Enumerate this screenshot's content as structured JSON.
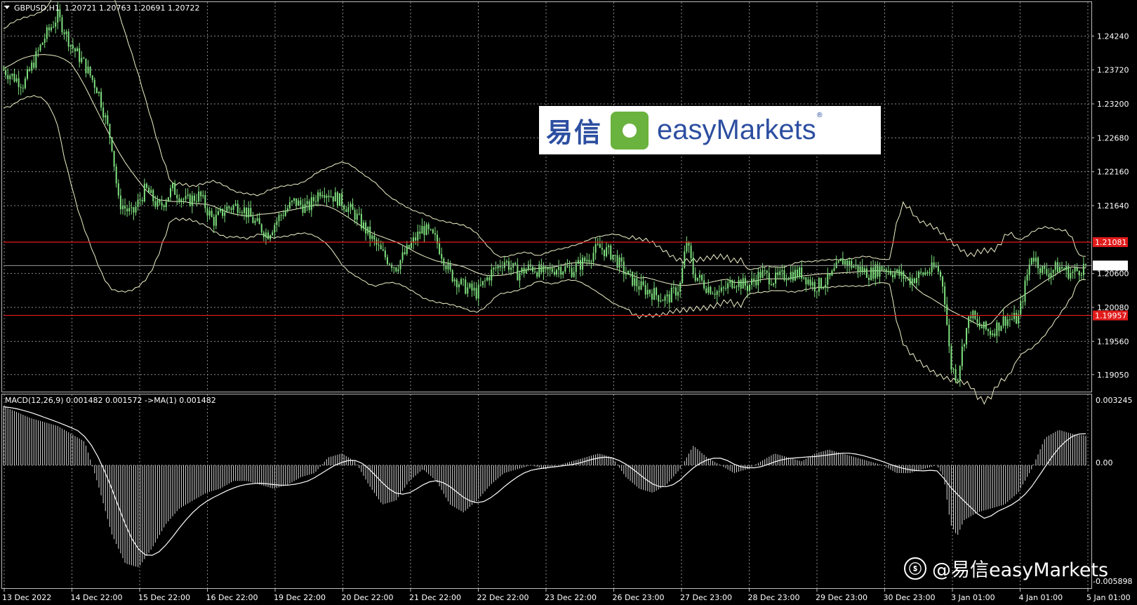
{
  "header": {
    "symbol": "GBPUSD,H1",
    "ohlc": "1.20721 1.20763 1.20691 1.20722",
    "dropdown_icon": "triangle-down-icon"
  },
  "price_axis": {
    "ticks": [
      "1.24240",
      "1.23720",
      "1.23200",
      "1.22680",
      "1.22160",
      "1.21640",
      "1.21081",
      "1.20600",
      "1.20080",
      "1.19957",
      "1.19560",
      "1.19050"
    ],
    "current_price": "1.20722",
    "resistance_label": "1.21081",
    "support_label": "1.19957"
  },
  "indicator": {
    "label": "MACD(12,26,9) 0.001482 0.001572  ->MA(1) 0.001482",
    "axis_top": "0.003245",
    "axis_zero": "0.00",
    "axis_bottom": "-0.005898"
  },
  "time_axis": [
    "13 Dec 2022",
    "14 Dec 22:00",
    "15 Dec 22:00",
    "16 Dec 22:00",
    "19 Dec 22:00",
    "20 Dec 22:00",
    "21 Dec 22:00",
    "22 Dec 22:00",
    "23 Dec 22:00",
    "26 Dec 23:00",
    "27 Dec 23:00",
    "28 Dec 23:00",
    "29 Dec 23:00",
    "30 Dec 23:00",
    "3 Jan 01:00",
    "4 Jan 01:00",
    "5 Jan 01:00"
  ],
  "logo": {
    "cn": "易信",
    "en": "easyMarkets",
    "reg": "®"
  },
  "watermark": {
    "text": "@易信easyMarkets",
    "icon": "weibo-icon"
  },
  "colors": {
    "candle": "#7ee07e",
    "grid": "#8a8a8a",
    "level_line": "#e21b1b",
    "band": "#f0f0c8"
  },
  "chart_data": {
    "type": "line",
    "title": "GBPUSD,H1",
    "ylim": [
      1.188,
      1.2476
    ],
    "price_path": [
      [
        0,
        1.2372
      ],
      [
        3,
        1.235
      ],
      [
        6,
        1.242
      ],
      [
        8,
        1.2455
      ],
      [
        10,
        1.241
      ],
      [
        12,
        1.238
      ],
      [
        14,
        1.234
      ],
      [
        16,
        1.226
      ],
      [
        17,
        1.217
      ],
      [
        19,
        1.215
      ],
      [
        21,
        1.219
      ],
      [
        23,
        1.216
      ],
      [
        25,
        1.219
      ],
      [
        27,
        1.217
      ],
      [
        29,
        1.218
      ],
      [
        31,
        1.214
      ],
      [
        33,
        1.216
      ],
      [
        35,
        1.2165
      ],
      [
        37,
        1.214
      ],
      [
        39,
        1.212
      ],
      [
        41,
        1.215
      ],
      [
        43,
        1.217
      ],
      [
        45,
        1.216
      ],
      [
        47,
        1.219
      ],
      [
        50,
        1.217
      ],
      [
        52,
        1.215
      ],
      [
        54,
        1.212
      ],
      [
        56,
        1.209
      ],
      [
        58,
        1.207
      ],
      [
        60,
        1.21
      ],
      [
        62,
        1.213
      ],
      [
        64,
        1.211
      ],
      [
        66,
        1.206
      ],
      [
        68,
        1.204
      ],
      [
        70,
        1.203
      ],
      [
        72,
        1.206
      ],
      [
        74,
        1.208
      ],
      [
        76,
        1.206
      ],
      [
        78,
        1.207
      ],
      [
        80,
        1.206
      ],
      [
        82,
        1.207
      ],
      [
        84,
        1.2065
      ],
      [
        86,
        1.208
      ],
      [
        88,
        1.21
      ],
      [
        90,
        1.209
      ],
      [
        92,
        1.206
      ],
      [
        94,
        1.204
      ],
      [
        96,
        1.203
      ],
      [
        98,
        1.202
      ],
      [
        100,
        1.204
      ],
      [
        101,
        1.211
      ],
      [
        102,
        1.206
      ],
      [
        104,
        1.204
      ],
      [
        106,
        1.203
      ],
      [
        108,
        1.205
      ],
      [
        110,
        1.204
      ],
      [
        112,
        1.206
      ],
      [
        114,
        1.205
      ],
      [
        116,
        1.206
      ],
      [
        118,
        1.206
      ],
      [
        120,
        1.204
      ],
      [
        122,
        1.205
      ],
      [
        124,
        1.208
      ],
      [
        126,
        1.207
      ],
      [
        128,
        1.206
      ],
      [
        130,
        1.207
      ],
      [
        132,
        1.206
      ],
      [
        134,
        1.205
      ],
      [
        136,
        1.206
      ],
      [
        138,
        1.207
      ],
      [
        139,
        1.204
      ],
      [
        140,
        1.192
      ],
      [
        141,
        1.19
      ],
      [
        142,
        1.196
      ],
      [
        143,
        1.2
      ],
      [
        144,
        1.198
      ],
      [
        146,
        1.197
      ],
      [
        148,
        1.199
      ],
      [
        150,
        1.199
      ],
      [
        152,
        1.209
      ],
      [
        154,
        1.206
      ],
      [
        156,
        1.207
      ],
      [
        158,
        1.206
      ],
      [
        160,
        1.2072
      ]
    ],
    "macd_ylim": [
      -0.005898,
      0.003245
    ],
    "macd_path": [
      [
        0,
        0.003
      ],
      [
        4,
        0.0024
      ],
      [
        8,
        0.002
      ],
      [
        12,
        0.0012
      ],
      [
        14,
        -0.001
      ],
      [
        16,
        -0.0035
      ],
      [
        18,
        -0.005
      ],
      [
        20,
        -0.0052
      ],
      [
        22,
        -0.0042
      ],
      [
        24,
        -0.003
      ],
      [
        26,
        -0.0022
      ],
      [
        28,
        -0.0018
      ],
      [
        30,
        -0.0014
      ],
      [
        32,
        -0.0012
      ],
      [
        34,
        -0.0008
      ],
      [
        36,
        -0.0008
      ],
      [
        38,
        -0.001
      ],
      [
        40,
        -0.0012
      ],
      [
        42,
        -0.001
      ],
      [
        44,
        -0.0006
      ],
      [
        46,
        -0.0004
      ],
      [
        48,
        0.0004
      ],
      [
        50,
        0.0006
      ],
      [
        52,
        0.0002
      ],
      [
        54,
        -0.001
      ],
      [
        56,
        -0.002
      ],
      [
        58,
        -0.0018
      ],
      [
        60,
        -0.0008
      ],
      [
        62,
        -0.0002
      ],
      [
        64,
        -0.0008
      ],
      [
        66,
        -0.002
      ],
      [
        68,
        -0.0024
      ],
      [
        70,
        -0.0018
      ],
      [
        72,
        -0.001
      ],
      [
        74,
        -0.0004
      ],
      [
        76,
        -0.0002
      ],
      [
        78,
        0.0
      ],
      [
        80,
        -0.0002
      ],
      [
        82,
        0.0
      ],
      [
        84,
        0.0002
      ],
      [
        86,
        0.0004
      ],
      [
        88,
        0.0006
      ],
      [
        90,
        0.0004
      ],
      [
        92,
        -0.0006
      ],
      [
        94,
        -0.0012
      ],
      [
        96,
        -0.0014
      ],
      [
        98,
        -0.001
      ],
      [
        100,
        -0.0002
      ],
      [
        102,
        0.001
      ],
      [
        104,
        0.0004
      ],
      [
        106,
        0.0
      ],
      [
        108,
        -0.0004
      ],
      [
        110,
        -0.0002
      ],
      [
        112,
        0.0002
      ],
      [
        114,
        0.0006
      ],
      [
        116,
        0.0004
      ],
      [
        118,
        0.0002
      ],
      [
        120,
        0.0006
      ],
      [
        122,
        0.0008
      ],
      [
        124,
        0.0006
      ],
      [
        126,
        0.0004
      ],
      [
        128,
        0.0002
      ],
      [
        130,
        0.0
      ],
      [
        132,
        -0.0004
      ],
      [
        134,
        -0.0004
      ],
      [
        136,
        -0.0002
      ],
      [
        138,
        0.0
      ],
      [
        139,
        -0.0006
      ],
      [
        140,
        -0.003
      ],
      [
        141,
        -0.0036
      ],
      [
        142,
        -0.0028
      ],
      [
        144,
        -0.0024
      ],
      [
        146,
        -0.0022
      ],
      [
        148,
        -0.002
      ],
      [
        150,
        -0.0014
      ],
      [
        152,
        -0.0002
      ],
      [
        154,
        0.0014
      ],
      [
        156,
        0.0018
      ],
      [
        158,
        0.0016
      ],
      [
        160,
        0.0015
      ]
    ]
  }
}
